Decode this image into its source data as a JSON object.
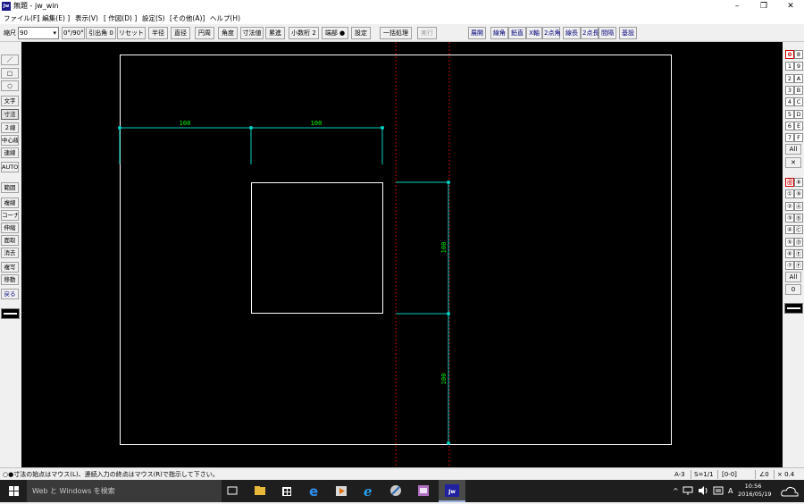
{
  "window": {
    "app_icon_text": "Jw",
    "title": "無題 - jw_win",
    "minimize_glyph": "–",
    "maximize_glyph": "❐",
    "close_glyph": "✕"
  },
  "menu": [
    "ファイル(F)",
    "[ 編集(E) ]",
    "表示(V)",
    "[ 作図(D) ]",
    "設定(S)",
    "[その他(A)]",
    "ヘルプ(H)"
  ],
  "toolbar": {
    "scale_label": "縮尺",
    "scale_value": "90",
    "angle_label": "0°/90°",
    "leader_label": "引出角 0",
    "reset_label": "リセット",
    "radius_label": "半径",
    "diameter_label": "直径",
    "circumference_label": "円周",
    "angle_btn_label": "角度",
    "dim_value_label": "寸法値",
    "accumulate_label": "累進",
    "decimal_label": "小数桁 2",
    "endpoint_label": "端部 ●",
    "settings_label": "設定",
    "batch_label": "一括処理",
    "execute_label": "実行",
    "expand_label": "展開",
    "line_angle_label": "線角",
    "vertical_label": "鉛直",
    "x_axis_label": "X軸",
    "two_point_angle_label": "2点角",
    "line_length_label": "線長",
    "two_point_length_label": "2点長",
    "spacing_label": "間隔",
    "reference_label": "基設"
  },
  "left_tools": {
    "line_glyph": "／",
    "rect_glyph": "□",
    "circle_glyph": "○",
    "text": "文字",
    "dimension": "寸法",
    "double_line": "２線",
    "center_line": "中心線",
    "continuous": "連線",
    "auto": "AUTO",
    "range": "範囲",
    "multi_line": "複線",
    "corner": "コーナー",
    "stretch": "伸縮",
    "fillet": "面取",
    "erase": "消去",
    "copy": "複写",
    "move": "移動",
    "undo": "戻る"
  },
  "layers": {
    "group_pairs": [
      [
        "0",
        "8"
      ],
      [
        "1",
        "9"
      ],
      [
        "2",
        "A"
      ],
      [
        "3",
        "B"
      ],
      [
        "4",
        "C"
      ],
      [
        "5",
        "D"
      ],
      [
        "6",
        "E"
      ],
      [
        "7",
        "F"
      ]
    ],
    "group_all": "All",
    "group_x": "✕",
    "layer_pairs": [
      [
        "⓪",
        "⑧"
      ],
      [
        "①",
        "⑨"
      ],
      [
        "②",
        "Ⓐ"
      ],
      [
        "③",
        "Ⓑ"
      ],
      [
        "④",
        "Ⓒ"
      ],
      [
        "⑤",
        "Ⓓ"
      ],
      [
        "⑥",
        "Ⓔ"
      ],
      [
        "⑦",
        "Ⓕ"
      ]
    ],
    "layer_all": "All",
    "layer_zero": "0"
  },
  "drawing": {
    "dim_labels": [
      "100",
      "100",
      "100",
      "100"
    ],
    "colors": {
      "background": "#000000",
      "frame": "#ffffff",
      "dimension": "#00d0c0",
      "dim_text": "#00ff00",
      "guide": "#c00000"
    }
  },
  "status": {
    "message": "○●寸法の始点はマウス(L)、連続入力の終点はマウス(R)で指示して下さい。",
    "paper": "A-3",
    "scale": "S=1/1",
    "layer": "[0-0]",
    "angle": "∠0",
    "factor": "× 0.4"
  },
  "taskbar": {
    "search_placeholder": "Web と Windows を検索",
    "time": "10:56",
    "date": "2016/05/19",
    "ime": "A"
  }
}
